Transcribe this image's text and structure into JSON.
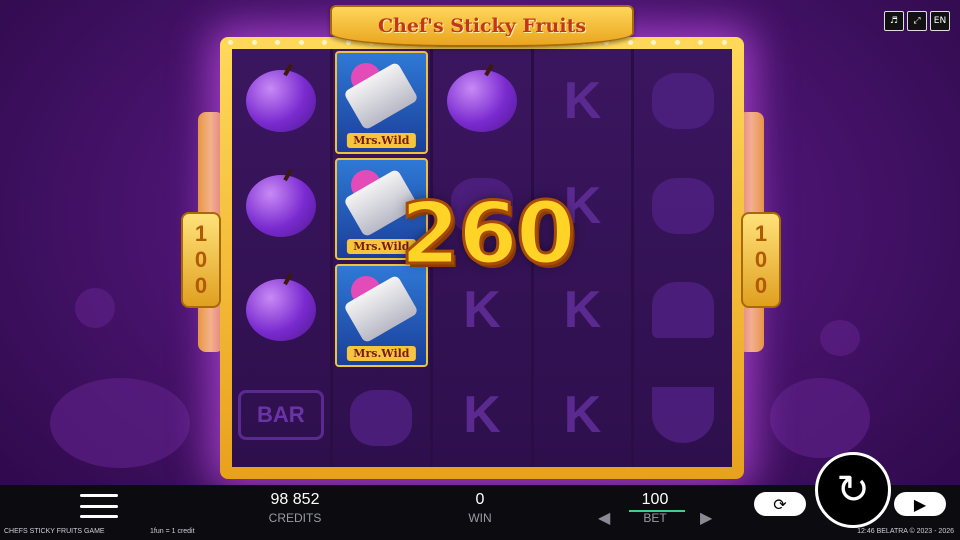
{
  "game": {
    "title": "Chef's Sticky Fruits"
  },
  "top_controls": {
    "sound_icon": "speaker-icon",
    "fullscreen_icon": "fullscreen-icon",
    "language": "EN"
  },
  "reels": [
    [
      "plum",
      "plum",
      "plum",
      "BAR"
    ],
    [
      "wild",
      "wild",
      "wild",
      "chef"
    ],
    [
      "plum",
      "plum",
      "K",
      "K"
    ],
    [
      "K",
      "K",
      "K",
      "K"
    ],
    [
      "lemon",
      "chef",
      "bell",
      "watermelon"
    ]
  ],
  "wild_label": "Mrs.Wild",
  "bar_label": "BAR",
  "k_label": "K",
  "side_multiplier_left": [
    "1",
    "0",
    "0"
  ],
  "side_multiplier_right": [
    "1",
    "0",
    "0"
  ],
  "win_amount": "260",
  "bottom_bar": {
    "credits_value": "98 852",
    "credits_label": "CREDITS",
    "win_value": "0",
    "win_label": "WIN",
    "bet_value": "100",
    "bet_label": "BET"
  },
  "footer": {
    "game_name": "CHEFS STICKY FRUITS GAME",
    "rate": "1fun = 1 credit",
    "time_copyright": "12:46   BELATRA © 2023 - 2026"
  },
  "colors": {
    "accent_gold": "#ffd426",
    "bet_indicator": "#3cd08a",
    "background": "#4a1470"
  }
}
